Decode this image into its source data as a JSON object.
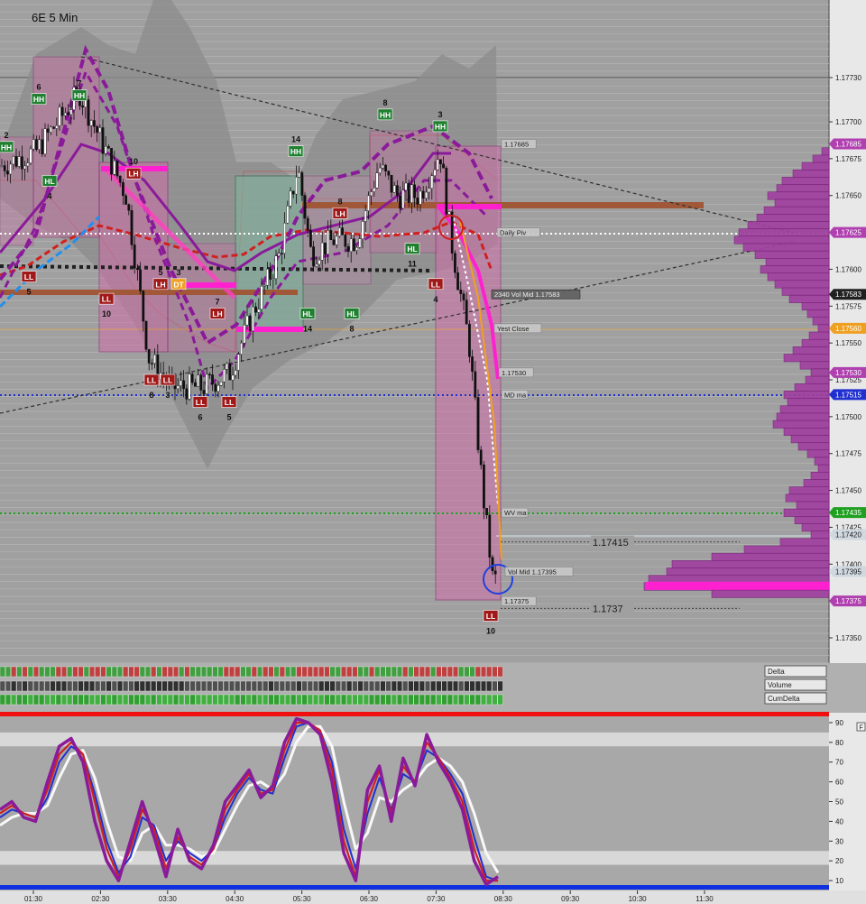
{
  "chart_data": {
    "type": "candlestick",
    "title": "6E 5 Min",
    "price_axis": {
      "ticks": [
        "1.17730",
        "1.17700",
        "1.17675",
        "1.17650",
        "1.17625",
        "1.17600",
        "1.17575",
        "1.17550",
        "1.17525",
        "1.17500",
        "1.17475",
        "1.17450",
        "1.17425",
        "1.17400",
        "1.17375",
        "1.17350"
      ],
      "tick_values": [
        1.1773,
        1.177,
        1.17675,
        1.1765,
        1.17625,
        1.176,
        1.17575,
        1.1755,
        1.17525,
        1.175,
        1.17475,
        1.1745,
        1.17425,
        1.174,
        1.17375,
        1.1735
      ],
      "highlight_labels": [
        {
          "text": "1.17685",
          "value": 1.17685,
          "color": "#b040b0"
        },
        {
          "text": "1.17625",
          "value": 1.17625,
          "color": "#b040b0"
        },
        {
          "text": "1.17583",
          "value": 1.17583,
          "color": "#202020"
        },
        {
          "text": "1.17560",
          "value": 1.1756,
          "color": "#f0a020"
        },
        {
          "text": "1.17530",
          "value": 1.1753,
          "color": "#b040b0"
        },
        {
          "text": "1.17515",
          "value": 1.17515,
          "color": "#2030d0"
        },
        {
          "text": "1.17435",
          "value": 1.17435,
          "color": "#20a020"
        },
        {
          "text": "1.17420",
          "value": 1.1742,
          "color": "#d0d8e0"
        },
        {
          "text": "1.17395",
          "value": 1.17395,
          "color": "#d0d8e0"
        },
        {
          "text": "1.17375",
          "value": 1.17375,
          "color": "#b040b0"
        }
      ]
    },
    "time_axis": {
      "ticks": [
        "01:30",
        "02:30",
        "03:30",
        "04:30",
        "05:30",
        "06:30",
        "07:30",
        "08:30",
        "09:30",
        "10:30",
        "11:30"
      ]
    },
    "price_path": [
      [
        0,
        1.1767
      ],
      [
        40,
        1.1768
      ],
      [
        88,
        1.1772
      ],
      [
        110,
        1.1769
      ],
      [
        140,
        1.1765
      ],
      [
        165,
        1.1754
      ],
      [
        190,
        1.1752
      ],
      [
        225,
        1.1752
      ],
      [
        255,
        1.1753
      ],
      [
        280,
        1.1757
      ],
      [
        310,
        1.1761
      ],
      [
        330,
        1.1767
      ],
      [
        345,
        1.1761
      ],
      [
        370,
        1.1762
      ],
      [
        395,
        1.1762
      ],
      [
        420,
        1.1767
      ],
      [
        440,
        1.1765
      ],
      [
        465,
        1.1765
      ],
      [
        488,
        1.1768
      ],
      [
        500,
        1.1762
      ],
      [
        520,
        1.1755
      ],
      [
        535,
        1.1745
      ],
      [
        548,
        1.1738
      ],
      [
        553,
        1.1742
      ]
    ],
    "annotations": [
      {
        "text": "Daily Piv",
        "value": 1.17625
      },
      {
        "text": "2340 Vol Mid 1.17583",
        "value": 1.17583
      },
      {
        "text": "Yest Close",
        "value": 1.1756
      },
      {
        "text": "MD ma",
        "value": 1.17515
      },
      {
        "text": "WV ma",
        "value": 1.17435
      },
      {
        "text": "1.17415",
        "value": 1.17415
      },
      {
        "text": "Vol Mid 1.17395",
        "value": 1.17395
      },
      {
        "text": "1.17375",
        "value": 1.17375
      },
      {
        "text": "1.1737",
        "value": 1.1737
      },
      {
        "text": "1.17685",
        "value": 1.17685
      },
      {
        "text": "1.17530",
        "value": 1.1753
      }
    ],
    "swing_labels": [
      {
        "text": "HH",
        "kind": "hh",
        "x": 88,
        "price": 1.17718,
        "num": "7"
      },
      {
        "text": "HH",
        "kind": "hh",
        "x": 43,
        "price": 1.177155,
        "num": "6"
      },
      {
        "text": "HH",
        "kind": "hh",
        "x": 7,
        "price": 1.17683,
        "num": "2"
      },
      {
        "text": "HL",
        "kind": "hl",
        "x": 55,
        "price": 1.1766,
        "num": "4"
      },
      {
        "text": "LH",
        "kind": "lh",
        "x": 148,
        "price": 1.17665,
        "num": "10"
      },
      {
        "text": "LL",
        "kind": "ll",
        "x": 32,
        "price": 1.17595,
        "num": "5"
      },
      {
        "text": "LL",
        "kind": "ll",
        "x": 118,
        "price": 1.1758,
        "num": "10"
      },
      {
        "text": "LH",
        "kind": "lh",
        "x": 178,
        "price": 1.1759,
        "num": "5"
      },
      {
        "text": "DT",
        "kind": "dt",
        "x": 198,
        "price": 1.1759,
        "num": "3"
      },
      {
        "text": "LL",
        "kind": "ll",
        "x": 168,
        "price": 1.17525,
        "num": "8"
      },
      {
        "text": "LL",
        "kind": "ll",
        "x": 186,
        "price": 1.17525,
        "num": "3"
      },
      {
        "text": "LL",
        "kind": "ll",
        "x": 222,
        "price": 1.1751,
        "num": "6"
      },
      {
        "text": "LL",
        "kind": "ll",
        "x": 254,
        "price": 1.1751,
        "num": "5"
      },
      {
        "text": "LH",
        "kind": "lh",
        "x": 241,
        "price": 1.1757,
        "num": "7"
      },
      {
        "text": "HH",
        "kind": "hh",
        "x": 328,
        "price": 1.1768,
        "num": "14"
      },
      {
        "text": "HL",
        "kind": "hl",
        "x": 341,
        "price": 1.1757,
        "num": "14"
      },
      {
        "text": "LH",
        "kind": "lh",
        "x": 377,
        "price": 1.17638,
        "num": "8"
      },
      {
        "text": "HL",
        "kind": "hl",
        "x": 390,
        "price": 1.1757,
        "num": "8"
      },
      {
        "text": "HH",
        "kind": "hh",
        "x": 427,
        "price": 1.17705,
        "num": "8"
      },
      {
        "text": "HH",
        "kind": "hh",
        "x": 488,
        "price": 1.17697,
        "num": "3"
      },
      {
        "text": "HL",
        "kind": "hl",
        "x": 457,
        "price": 1.17614,
        "num": "11"
      },
      {
        "text": "LL",
        "kind": "ll",
        "x": 483,
        "price": 1.1759,
        "num": "4"
      },
      {
        "text": "LL",
        "kind": "ll",
        "x": 544,
        "price": 1.17365,
        "num": "10"
      }
    ],
    "volume_profile": {
      "prices": [
        1.1768,
        1.17675,
        1.1767,
        1.17665,
        1.1766,
        1.17655,
        1.1765,
        1.17645,
        1.1764,
        1.17635,
        1.1763,
        1.17625,
        1.1762,
        1.17615,
        1.1761,
        1.17605,
        1.176,
        1.17595,
        1.1759,
        1.17585,
        1.1758,
        1.17575,
        1.1757,
        1.17565,
        1.1756,
        1.17555,
        1.1755,
        1.17545,
        1.1754,
        1.17535,
        1.1753,
        1.17525,
        1.1752,
        1.17515,
        1.1751,
        1.17505,
        1.175,
        1.17495,
        1.1749,
        1.17485,
        1.1748,
        1.17475,
        1.1747,
        1.17465,
        1.1746,
        1.17455,
        1.1745,
        1.17445,
        1.1744,
        1.17435,
        1.1743,
        1.17425,
        1.1742,
        1.17415,
        1.1741,
        1.17405,
        1.174,
        1.17395,
        1.1739,
        1.17385,
        1.1738
      ],
      "sizes": [
        8,
        18,
        30,
        40,
        52,
        58,
        68,
        60,
        72,
        80,
        90,
        100,
        105,
        95,
        82,
        70,
        76,
        68,
        60,
        52,
        44,
        30,
        24,
        18,
        12,
        22,
        30,
        40,
        50,
        32,
        20,
        26,
        38,
        50,
        46,
        54,
        58,
        62,
        50,
        42,
        34,
        24,
        16,
        12,
        20,
        28,
        44,
        48,
        36,
        50,
        38,
        30,
        20,
        54,
        94,
        130,
        174,
        180,
        200,
        205,
        130
      ]
    },
    "poc_price": 1.17385,
    "oscillator": {
      "ticks": [
        "90",
        "80",
        "70",
        "60",
        "50",
        "40",
        "30",
        "20",
        "10"
      ],
      "tick_values": [
        90,
        80,
        70,
        60,
        50,
        40,
        30,
        20,
        10
      ],
      "ylim": [
        5,
        95
      ],
      "series": [
        {
          "name": "",
          "color": "#8a1a9a",
          "values": [
            46,
            50,
            42,
            40,
            60,
            78,
            82,
            70,
            40,
            20,
            10,
            30,
            50,
            32,
            12,
            36,
            20,
            16,
            28,
            50,
            58,
            66,
            52,
            58,
            80,
            92,
            90,
            84,
            60,
            24,
            10,
            56,
            68,
            40,
            72,
            58,
            84,
            70,
            60,
            46,
            20,
            8,
            12
          ]
        },
        {
          "name": "",
          "color": "#d02020",
          "values": [
            44,
            48,
            44,
            42,
            56,
            74,
            80,
            74,
            50,
            26,
            12,
            26,
            46,
            36,
            16,
            32,
            22,
            18,
            26,
            46,
            56,
            64,
            54,
            56,
            76,
            90,
            90,
            86,
            66,
            30,
            12,
            50,
            66,
            44,
            68,
            60,
            80,
            72,
            62,
            50,
            26,
            10,
            10
          ]
        },
        {
          "name": "",
          "color": "#2030d0",
          "values": [
            42,
            46,
            44,
            42,
            52,
            70,
            78,
            74,
            54,
            30,
            14,
            22,
            42,
            38,
            20,
            30,
            24,
            20,
            26,
            42,
            54,
            62,
            56,
            54,
            72,
            88,
            90,
            86,
            70,
            36,
            16,
            44,
            62,
            46,
            64,
            60,
            76,
            72,
            64,
            54,
            32,
            12,
            10
          ]
        },
        {
          "name": "",
          "color": "#f8f8f8",
          "values": [
            38,
            42,
            44,
            44,
            48,
            62,
            74,
            76,
            62,
            40,
            22,
            20,
            34,
            38,
            28,
            28,
            26,
            22,
            24,
            36,
            48,
            58,
            60,
            56,
            64,
            80,
            88,
            88,
            78,
            50,
            26,
            34,
            52,
            50,
            56,
            60,
            68,
            72,
            68,
            60,
            44,
            24,
            14
          ]
        }
      ]
    },
    "right_panel_labels": [
      "Delta",
      "Volume",
      "CumDelta"
    ],
    "panel_button": "F"
  },
  "colors": {
    "background": "#a0a0a0",
    "bull": "#ffffff",
    "bear": "#101010",
    "pink_band": "#e080c0",
    "profile": "#a040a0",
    "poc": "#ff20d0"
  }
}
